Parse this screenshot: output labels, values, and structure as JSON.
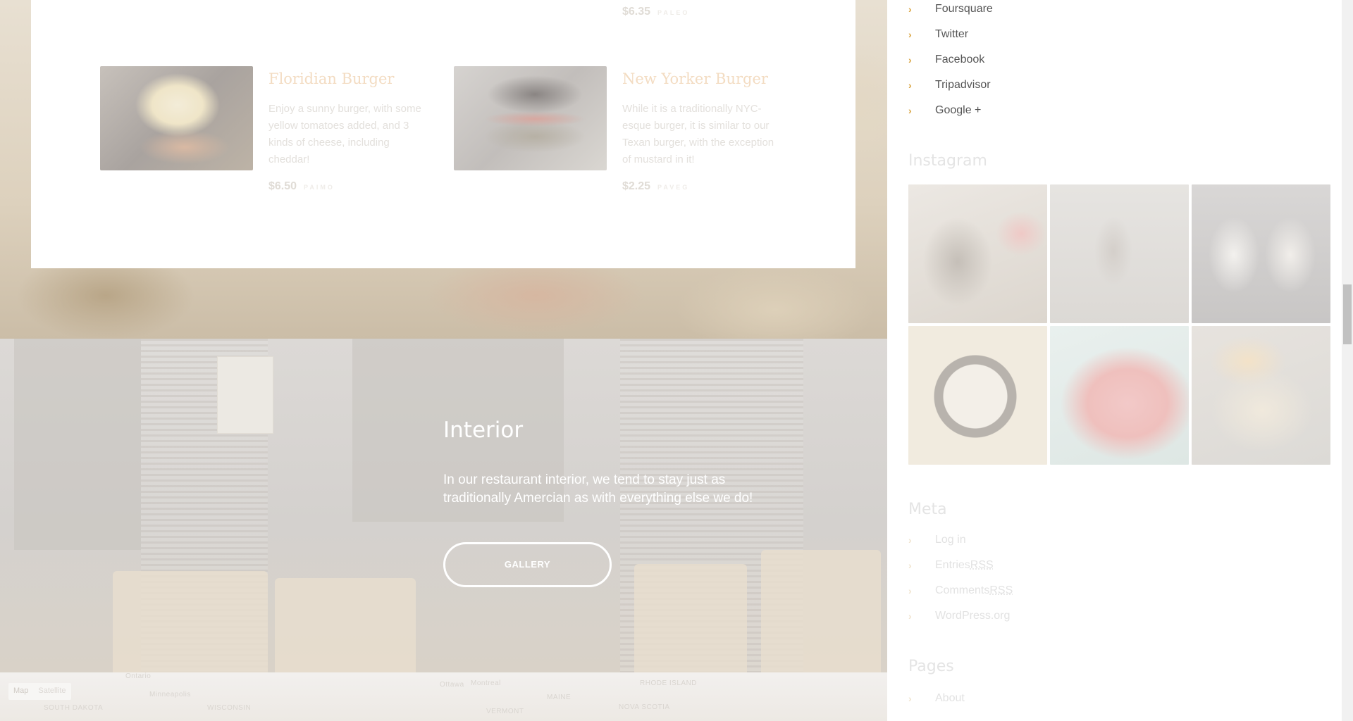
{
  "menu": {
    "partial_item": {
      "price": "$6.35",
      "tag": "PALEO"
    },
    "items": [
      {
        "name": "Floridian Burger",
        "description": "Enjoy a sunny burger, with some yellow tomatoes added, and 3 kinds of cheese, including cheddar!",
        "price": "$6.50",
        "tag": "PAIMO"
      },
      {
        "name": "New Yorker Burger",
        "description": "While it is a traditionally NYC-esque burger, it is similar to our Texan burger, with the exception of mustard in it!",
        "price": "$2.25",
        "tag": "PAVEG"
      }
    ]
  },
  "interior": {
    "title": "Interior",
    "text": "In our restaurant interior, we tend to stay just as traditionally Amercian as with everything else we do!",
    "button": "GALLERY"
  },
  "map": {
    "toggle": [
      "Map",
      "Satellite"
    ],
    "labels": [
      "Ontario",
      "Minneapolis",
      "SOUTH DAKOTA",
      "WISCONSIN",
      "Ottawa",
      "Montreal",
      "MAINE",
      "VERMONT",
      "RHODE ISLAND",
      "NOVA SCOTIA"
    ]
  },
  "sidebar": {
    "social_links": [
      "Foursquare",
      "Twitter",
      "Facebook",
      "Tripadvisor",
      "Google +"
    ],
    "instagram_title": "Instagram",
    "meta_title": "Meta",
    "meta_links": [
      {
        "label": "Log in",
        "abbr": ""
      },
      {
        "label": "Entries ",
        "abbr": "RSS"
      },
      {
        "label": "Comments ",
        "abbr": "RSS"
      },
      {
        "label": "WordPress.org",
        "abbr": ""
      }
    ],
    "pages_title": "Pages",
    "pages_links": [
      "About"
    ]
  },
  "colors": {
    "accent": "#d9a441",
    "link_text": "#555555"
  },
  "icons": {
    "list_bullet": "chevron-right-icon"
  }
}
